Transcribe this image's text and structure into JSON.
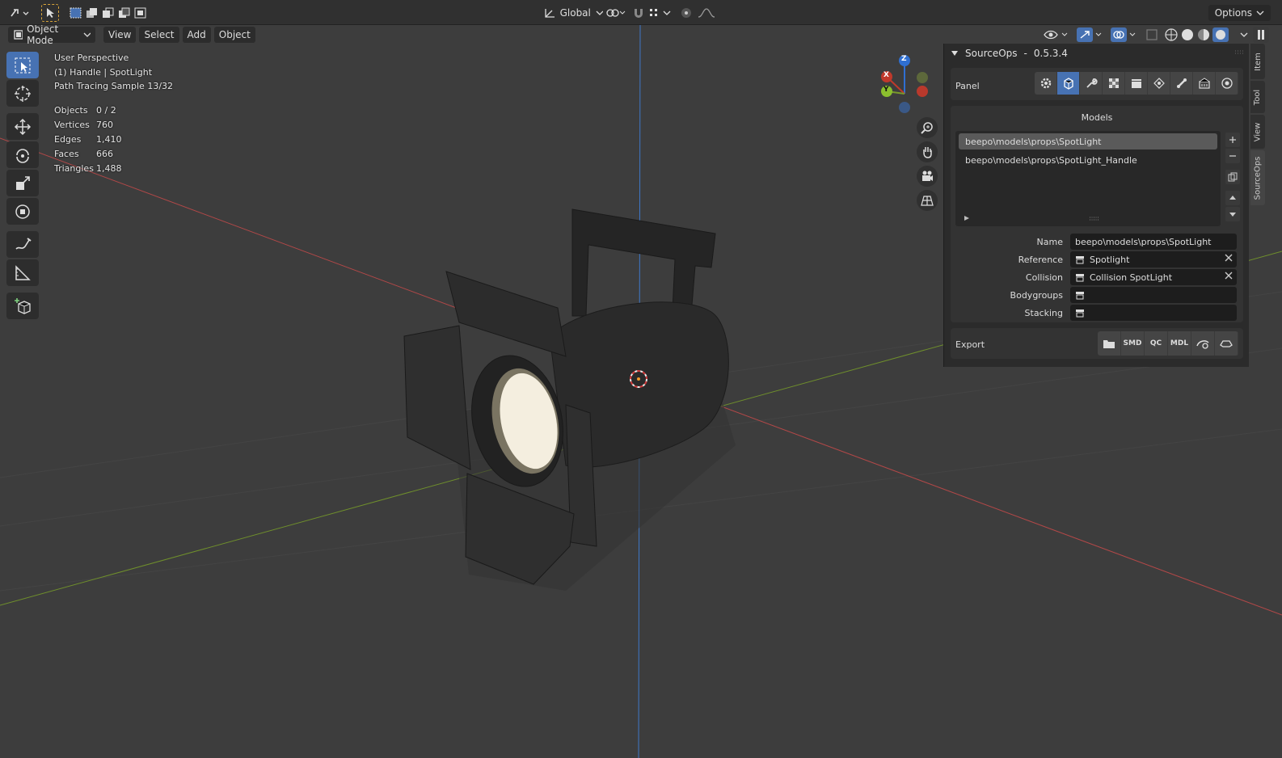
{
  "header": {
    "transform_orientation": "Global",
    "options_label": "Options"
  },
  "viewport_menu": {
    "mode": "Object Mode",
    "view": "View",
    "select": "Select",
    "add": "Add",
    "object": "Object"
  },
  "overlay": {
    "perspective": "User Perspective",
    "active_object": "(1) Handle | SpotLight",
    "render_status": "Path Tracing Sample 13/32"
  },
  "stats": [
    {
      "key": "Objects",
      "value": "0 / 2"
    },
    {
      "key": "Vertices",
      "value": "760"
    },
    {
      "key": "Edges",
      "value": "1,410"
    },
    {
      "key": "Faces",
      "value": "666"
    },
    {
      "key": "Triangles",
      "value": "1,488"
    }
  ],
  "gizmo": {
    "x": "X",
    "y": "Y",
    "z": "Z"
  },
  "sourceops": {
    "title": "SourceOps",
    "separator": "-",
    "version": "0.5.3.4",
    "panel_label": "Panel",
    "models_title": "Models",
    "models": [
      "beepo\\models\\props\\SpotLight",
      "beepo\\models\\props\\SpotLight_Handle"
    ],
    "selected_model_index": 0,
    "fields": {
      "name_label": "Name",
      "name_value": "beepo\\models\\props\\SpotLight",
      "reference_label": "Reference",
      "reference_value": "Spotlight",
      "collision_label": "Collision",
      "collision_value": "Collision SpotLight",
      "bodygroups_label": "Bodygroups",
      "stacking_label": "Stacking"
    },
    "export_label": "Export",
    "export_buttons": [
      "SMD",
      "QC",
      "MDL"
    ]
  },
  "side_tabs": [
    "Item",
    "Tool",
    "View",
    "SourceOps"
  ],
  "colors": {
    "accent": "#4772b3",
    "axis_x": "#c0392b",
    "axis_y": "#7a9a2a",
    "axis_z": "#2f6fd1"
  }
}
